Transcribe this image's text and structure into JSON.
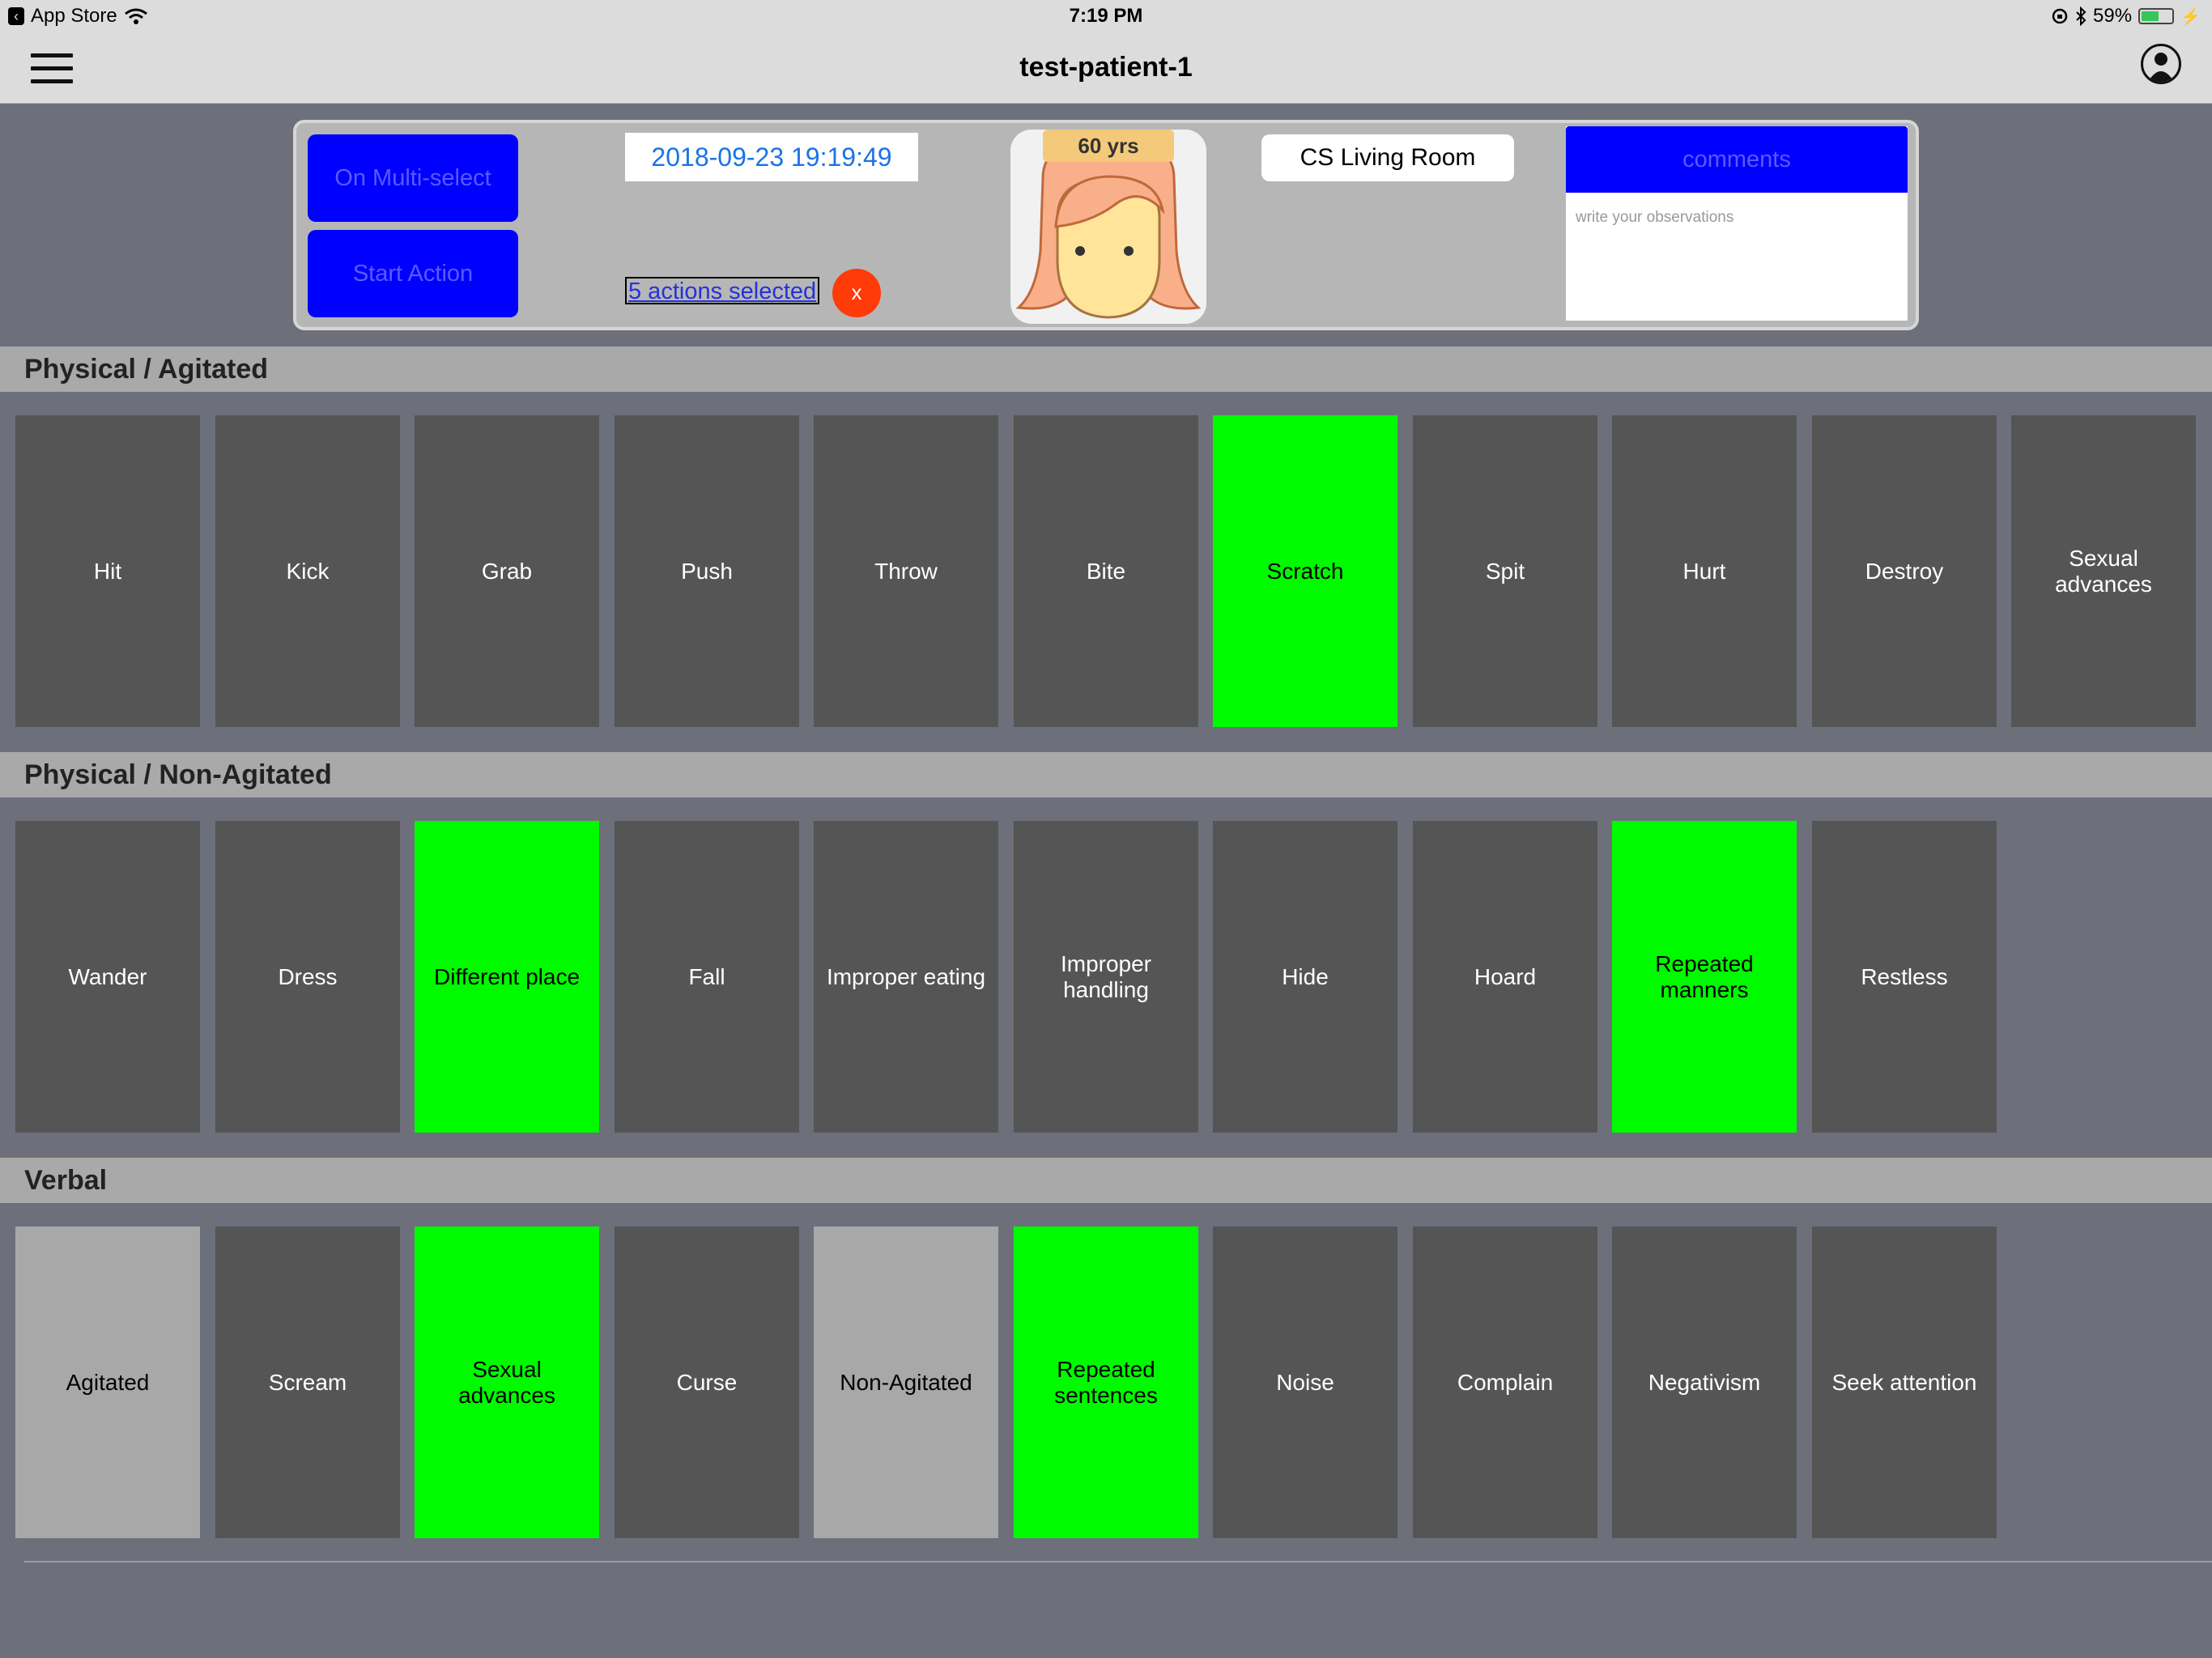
{
  "status_bar": {
    "back_app": "App Store",
    "time": "7:19 PM",
    "battery_pct": "59%",
    "battery_level": 0.59
  },
  "nav": {
    "title": "test-patient-1"
  },
  "header": {
    "multi_select_label": "On Multi-select",
    "start_action_label": "Start Action",
    "datetime": "2018-09-23 19:19:49",
    "selected_count_text": "5 actions selected",
    "clear_label": "x",
    "age_label": "60 yrs",
    "location": "CS Living Room",
    "comments_label": "comments",
    "comments_placeholder": "write your observations"
  },
  "sections": [
    {
      "title": "Physical / Agitated",
      "tiles": [
        {
          "label": "Hit",
          "state": "off"
        },
        {
          "label": "Kick",
          "state": "off"
        },
        {
          "label": "Grab",
          "state": "off"
        },
        {
          "label": "Push",
          "state": "off"
        },
        {
          "label": "Throw",
          "state": "off"
        },
        {
          "label": "Bite",
          "state": "off"
        },
        {
          "label": "Scratch",
          "state": "on"
        },
        {
          "label": "Spit",
          "state": "off"
        },
        {
          "label": "Hurt",
          "state": "off"
        },
        {
          "label": "Destroy",
          "state": "off"
        },
        {
          "label": "Sexual advances",
          "state": "off"
        }
      ]
    },
    {
      "title": "Physical / Non-Agitated",
      "tiles": [
        {
          "label": "Wander",
          "state": "off"
        },
        {
          "label": "Dress",
          "state": "off"
        },
        {
          "label": "Different place",
          "state": "on"
        },
        {
          "label": "Fall",
          "state": "off"
        },
        {
          "label": "Improper eating",
          "state": "off"
        },
        {
          "label": "Improper handling",
          "state": "off"
        },
        {
          "label": "Hide",
          "state": "off"
        },
        {
          "label": "Hoard",
          "state": "off"
        },
        {
          "label": "Repeated manners",
          "state": "on"
        },
        {
          "label": "Restless",
          "state": "off"
        }
      ]
    },
    {
      "title": "Verbal",
      "tiles": [
        {
          "label": "Agitated",
          "state": "light"
        },
        {
          "label": "Scream",
          "state": "off"
        },
        {
          "label": "Sexual advances",
          "state": "on"
        },
        {
          "label": "Curse",
          "state": "off"
        },
        {
          "label": "Non-Agitated",
          "state": "light"
        },
        {
          "label": "Repeated sentences",
          "state": "on"
        },
        {
          "label": "Noise",
          "state": "off"
        },
        {
          "label": "Complain",
          "state": "off"
        },
        {
          "label": "Negativism",
          "state": "off"
        },
        {
          "label": "Seek attention",
          "state": "off"
        }
      ]
    }
  ],
  "colors": {
    "background": "#6d707b",
    "selected_tile": "#00fa00",
    "default_tile": "#555555",
    "category_tile": "#a8a8a8",
    "primary_button": "#0000ff",
    "clear_button": "#ff3b0a"
  },
  "icons": {
    "menu": "hamburger-menu-icon",
    "profile": "user-profile-icon",
    "avatar": "female-avatar-icon",
    "wifi": "wifi-icon",
    "bluetooth": "bluetooth-icon"
  }
}
